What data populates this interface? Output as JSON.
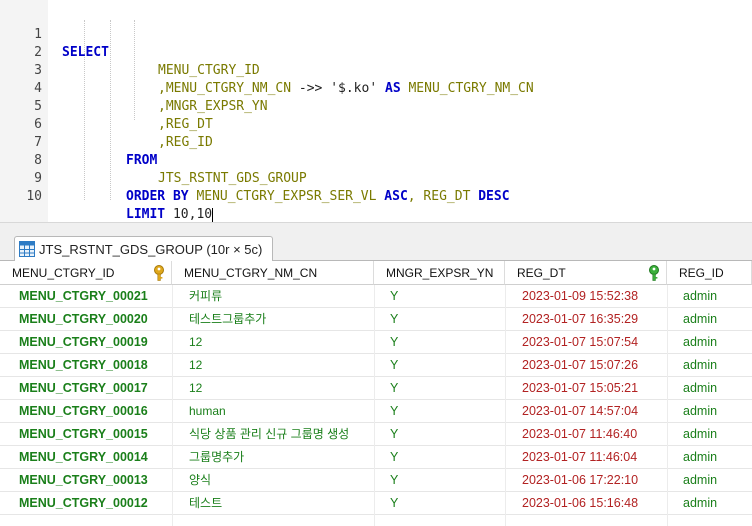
{
  "editor": {
    "lines": [
      {
        "n": "1"
      },
      {
        "n": "2"
      },
      {
        "n": "3"
      },
      {
        "n": "4"
      },
      {
        "n": "5"
      },
      {
        "n": "6"
      },
      {
        "n": "7"
      },
      {
        "n": "8"
      },
      {
        "n": "9"
      },
      {
        "n": "10"
      }
    ],
    "kw_select": "SELECT",
    "l2": "MENU_CTGRY_ID",
    "l3_a": ",MENU_CTGRY_NM_CN",
    "l3_op": " ->> ",
    "l3_str": "'$.ko'",
    "l3_as": " AS ",
    "l3_b": "MENU_CTGRY_NM_CN",
    "l4": ",MNGR_EXPSR_YN",
    "l5": ",REG_DT",
    "l6": ",REG_ID",
    "kw_from": "FROM",
    "l8": "JTS_RSTNT_GDS_GROUP",
    "kw_order": "ORDER BY",
    "l9_a": " MENU_CTGRY_EXPSR_SER_VL ",
    "kw_asc": "ASC",
    "l9_b": ", REG_DT ",
    "kw_desc": "DESC",
    "kw_limit": "LIMIT",
    "l10": " 10,10"
  },
  "tab": {
    "label": "JTS_RSTNT_GDS_GROUP (10r × 5c)"
  },
  "columns": [
    "MENU_CTGRY_ID",
    "MENU_CTGRY_NM_CN",
    "MNGR_EXPSR_YN",
    "REG_DT",
    "REG_ID"
  ],
  "rows": [
    [
      "MENU_CTGRY_00021",
      "커피류",
      "Y",
      "2023-01-09 15:52:38",
      "admin"
    ],
    [
      "MENU_CTGRY_00020",
      "테스트그룹추가",
      "Y",
      "2023-01-07 16:35:29",
      "admin"
    ],
    [
      "MENU_CTGRY_00019",
      "12",
      "Y",
      "2023-01-07 15:07:54",
      "admin"
    ],
    [
      "MENU_CTGRY_00018",
      "12",
      "Y",
      "2023-01-07 15:07:26",
      "admin"
    ],
    [
      "MENU_CTGRY_00017",
      "12",
      "Y",
      "2023-01-07 15:05:21",
      "admin"
    ],
    [
      "MENU_CTGRY_00016",
      "human",
      "Y",
      "2023-01-07 14:57:04",
      "admin"
    ],
    [
      "MENU_CTGRY_00015",
      "식당 상품 관리 신규 그룹명 생성",
      "Y",
      "2023-01-07 11:46:40",
      "admin"
    ],
    [
      "MENU_CTGRY_00014",
      "그룹명추가",
      "Y",
      "2023-01-07 11:46:04",
      "admin"
    ],
    [
      "MENU_CTGRY_00013",
      "양식",
      "Y",
      "2023-01-06 17:22:10",
      "admin"
    ],
    [
      "MENU_CTGRY_00012",
      "테스트",
      "Y",
      "2023-01-06 15:16:48",
      "admin"
    ]
  ],
  "icons": {
    "primary_key": "key-icon-gold",
    "index_key": "key-icon-green",
    "tab": "grid-icon"
  },
  "colors": {
    "keyword": "#0000c8",
    "identifier": "#7a7a00",
    "id_value": "#1a7f1a",
    "date_value": "#b22222"
  }
}
